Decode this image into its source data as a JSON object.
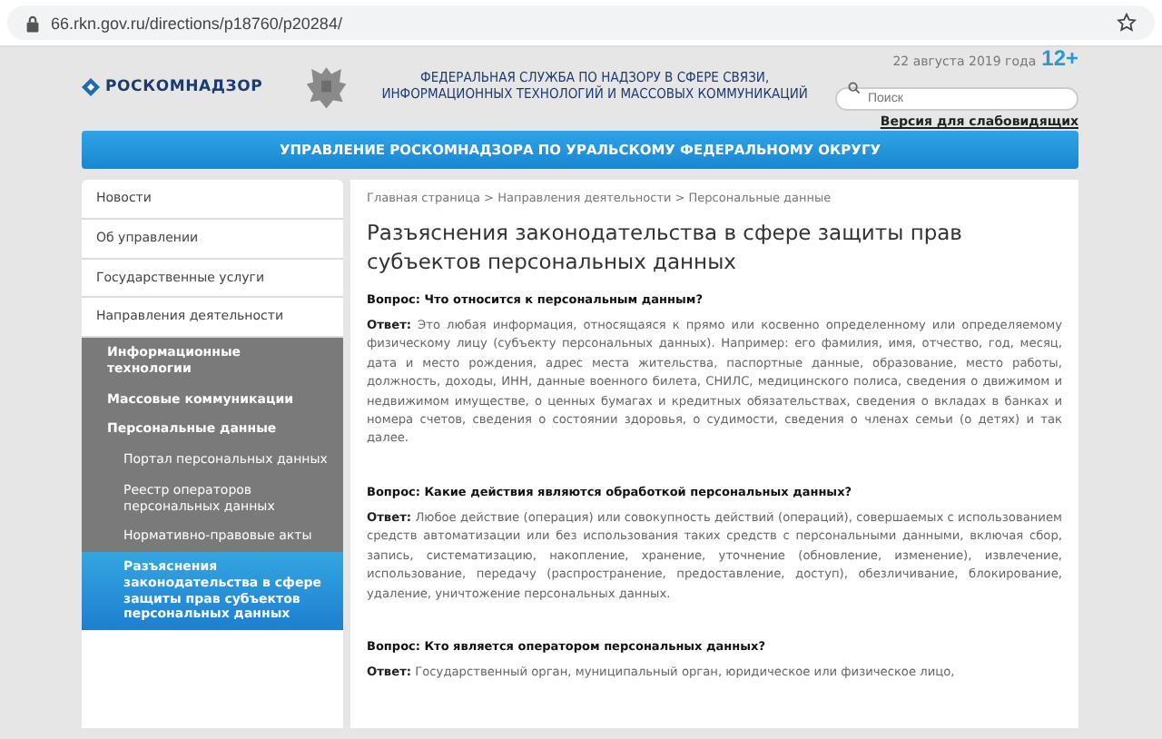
{
  "browser": {
    "url": "66.rkn.gov.ru/directions/p18760/p20284/"
  },
  "header": {
    "logo": "РОСКОМНАДЗОР",
    "agency": "ФЕДЕРАЛЬНАЯ СЛУЖБА ПО НАДЗОРУ В СФЕРЕ СВЯЗИ, ИНФОРМАЦИОННЫХ ТЕХНОЛОГИЙ И МАССОВЫХ КОММУНИКАЦИЙ",
    "date": "22 августа 2019 года",
    "age_rating": "12+",
    "search": {
      "placeholder": "Поиск"
    },
    "accessibility_link": "Версия для слабовидящих"
  },
  "banner": "УПРАВЛЕНИЕ РОСКОМНАДЗОРА ПО УРАЛЬСКОМУ ФЕДЕРАЛЬНОМУ ОКРУГУ",
  "sidebar": {
    "items": [
      {
        "label": "Новости",
        "selected": false
      },
      {
        "label": "Об управлении",
        "selected": false
      },
      {
        "label": "Государственные услуги",
        "selected": false
      },
      {
        "label": "Направления деятельности",
        "selected": false,
        "children": [
          {
            "label": "Информационные технологии",
            "selected": false
          },
          {
            "label": "Массовые коммуникации",
            "selected": false
          },
          {
            "label": "Персональные данные",
            "selected": false,
            "children": [
              {
                "label": "Портал персональных данных",
                "selected": false
              },
              {
                "label": "Реестр операторов персональных данных",
                "selected": false
              },
              {
                "label": "Нормативно-правовые акты",
                "selected": false
              },
              {
                "label": "Разъяснения законодательства в сфере защиты прав субъектов персональных данных",
                "selected": true
              }
            ]
          }
        ]
      }
    ]
  },
  "breadcrumb": "Главная страница > Направления деятельности > Персональные данные",
  "title": "Разъяснения законодательства в сфере защиты прав субъектов персональных данных",
  "faq": [
    {
      "question": "Вопрос: Что относится к персональным данным?",
      "answer": "**Ответ:** Это любая информация, относящаяся к прямо или косвенно определенному или определяемому физическому лицу (субъекту персональных данных). Например: его фамилия, имя, отчество, год, месяц, дата и место рождения, адрес места жительства, паспортные данные, образование, место работы, должность, доходы, ИНН, данные военного билета, СНИЛС, медицинского полиса, сведения о движимом и недвижимом имуществе, о ценных бумагах и кредитных обязательствах, сведения о вкладах в банках и номера счетов, сведения о состоянии здоровья, о судимости, сведения о членах семьи (о детях) и так далее."
    },
    {
      "question": "Вопрос: Какие действия являются обработкой персональных данных?",
      "answer": "**Ответ:** Любое действие (операция) или совокупность действий (операций), совершаемых с использованием средств автоматизации или без использования таких средств с персональными данными, включая сбор, запись, систематизацию, накопление, хранение, уточнение (обновление, изменение), извлечение, использование, передачу (распространение, предоставление, доступ), обезличивание, блокирование, удаление, уничтожение персональных данных."
    },
    {
      "question": "Вопрос: Кто является оператором персональных данных?",
      "answer": "**Ответ:** Государственный орган, муниципальный орган, юридическое или физическое лицо,"
    }
  ]
}
